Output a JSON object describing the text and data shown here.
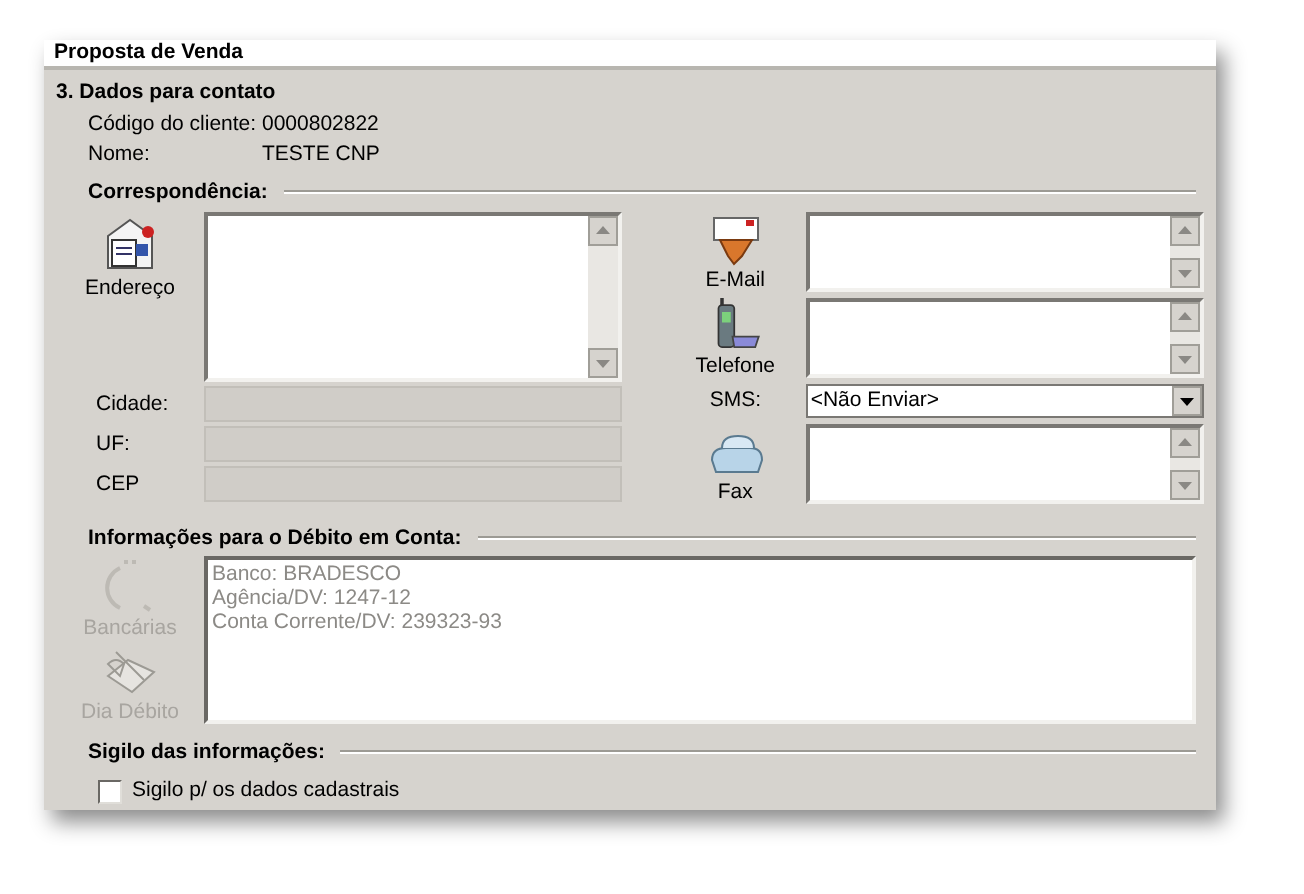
{
  "window": {
    "title": "Proposta de Venda"
  },
  "section": {
    "title": "3. Dados para contato"
  },
  "client_fields": [
    {
      "label": "Código do cliente:",
      "value": "0000802822"
    },
    {
      "label": "Nome:",
      "value": "TESTE CNP"
    }
  ],
  "correspondence": {
    "title": "Correspondência:",
    "address": {
      "label": "Endereço"
    },
    "address_fields": [
      {
        "label": "Cidade:",
        "disabled": true
      },
      {
        "label": "UF:",
        "disabled": true
      },
      {
        "label": "CEP",
        "disabled": true
      }
    ],
    "contacts": [
      {
        "kind": "email",
        "label": "E-Mail"
      },
      {
        "kind": "phone",
        "label": "Telefone"
      },
      {
        "kind": "dropdown",
        "label": "SMS:",
        "value": "<Não Enviar>"
      },
      {
        "kind": "fax",
        "label": "Fax"
      }
    ]
  },
  "debit": {
    "title": "Informações para o Débito em Conta:",
    "buttons": [
      {
        "kind": "bank",
        "label": "Bancárias",
        "disabled": true
      },
      {
        "kind": "day",
        "label": "Dia Débito",
        "disabled": true
      }
    ],
    "disabled": true,
    "lines": [
      "Banco: BRADESCO",
      "Agência/DV: 1247-12",
      "Conta Corrente/DV: 239323-93"
    ]
  },
  "privacy": {
    "title": "Sigilo das informações:",
    "checkbox": {
      "label": "Sigilo p/ os dados cadastrais",
      "checked": false
    }
  }
}
